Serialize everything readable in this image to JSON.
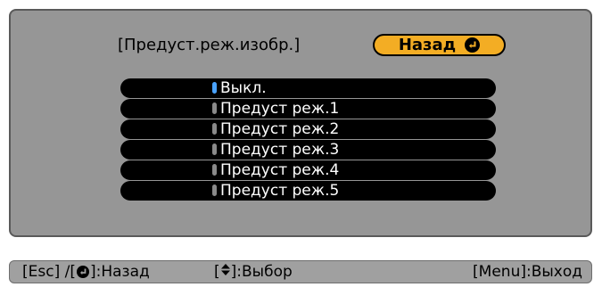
{
  "dialog": {
    "title": "[Предуст.реж.изобр.]",
    "back_label": "Назад"
  },
  "options": [
    {
      "label": "Выкл.",
      "selected": true
    },
    {
      "label": "Предуст реж.1",
      "selected": false
    },
    {
      "label": "Предуст реж.2",
      "selected": false
    },
    {
      "label": "Предуст реж.3",
      "selected": false
    },
    {
      "label": "Предуст реж.4",
      "selected": false
    },
    {
      "label": "Предуст реж.5",
      "selected": false
    }
  ],
  "footer": {
    "esc_prefix": "[Esc] /[",
    "esc_suffix": "]:Назад",
    "select_prefix": "[",
    "select_suffix": "]:Выбор",
    "menu_hint": "[Menu]:Выход"
  },
  "colors": {
    "panel_bg": "#969696",
    "back_button": "#f3ad24",
    "selected_marker": "#4aa3ff",
    "item_bg": "#000000"
  },
  "icons": {
    "enter": "enter-icon",
    "updown": "up-down-arrow-icon"
  }
}
